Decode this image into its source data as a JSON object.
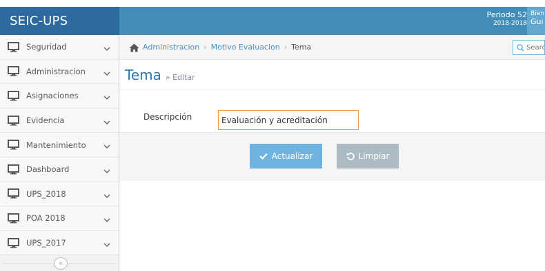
{
  "navbar": {
    "brand": "SEIC-UPS",
    "periodo_label": "Periodo 52",
    "periodo_range": "2018-2018",
    "user_line1": "Bien",
    "user_line2": "Gui"
  },
  "sidebar": {
    "items": [
      {
        "label": "Seguridad"
      },
      {
        "label": "Administracion"
      },
      {
        "label": "Asignaciones"
      },
      {
        "label": "Evidencia"
      },
      {
        "label": "Mantenimiento"
      },
      {
        "label": "Dashboard"
      },
      {
        "label": "UPS_2018"
      },
      {
        "label": "POA 2018"
      },
      {
        "label": "UPS_2017"
      }
    ],
    "collapse_symbol": "«"
  },
  "breadcrumb": {
    "items": [
      "Administracion",
      "Motivo Evaluacion",
      "Tema"
    ],
    "separator": "›",
    "search_placeholder": "Search"
  },
  "page": {
    "title": "Tema",
    "subtitle": "» Editar"
  },
  "form": {
    "descripcion_label": "Descripción",
    "descripcion_value": "Evaluación y acreditación"
  },
  "actions": {
    "update_label": "Actualizar",
    "clear_label": "Limpiar"
  },
  "colors": {
    "navbar": "#438eb9",
    "brand_bg": "#2c6aa0",
    "title": "#2679b5",
    "update_btn": "#6fb3e0",
    "clear_btn": "#abbac3",
    "input_focus_border": "#f59942"
  }
}
